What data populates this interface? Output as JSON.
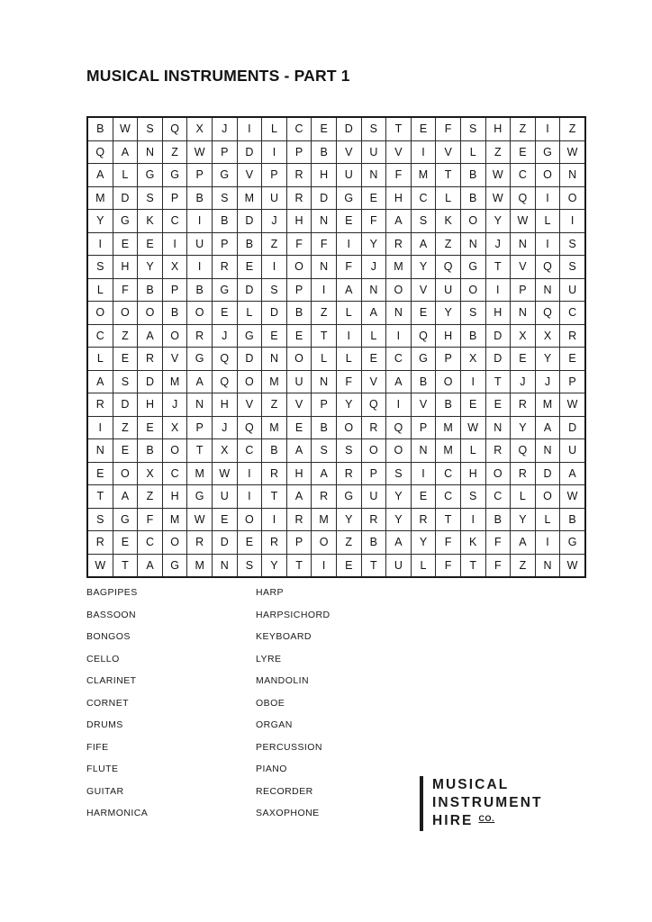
{
  "page": {
    "title": "MUSICAL INSTRUMENTS - PART 1",
    "background_color": "#ffffff",
    "text_color": "#111111"
  },
  "puzzle": {
    "type": "word-search",
    "rows": 20,
    "columns": 20,
    "border_color": "#1a1a1a",
    "grid": [
      [
        "B",
        "W",
        "S",
        "Q",
        "X",
        "J",
        "I",
        "L",
        "C",
        "E",
        "D",
        "S",
        "T",
        "E",
        "F",
        "S",
        "H",
        "Z",
        "I",
        "Z"
      ],
      [
        "Q",
        "A",
        "N",
        "Z",
        "W",
        "P",
        "D",
        "I",
        "P",
        "B",
        "V",
        "U",
        "V",
        "I",
        "V",
        "L",
        "Z",
        "E",
        "G",
        "W"
      ],
      [
        "A",
        "L",
        "G",
        "G",
        "P",
        "G",
        "V",
        "P",
        "R",
        "H",
        "U",
        "N",
        "F",
        "M",
        "T",
        "B",
        "W",
        "C",
        "O",
        "N"
      ],
      [
        "M",
        "D",
        "S",
        "P",
        "B",
        "S",
        "M",
        "U",
        "R",
        "D",
        "G",
        "E",
        "H",
        "C",
        "L",
        "B",
        "W",
        "Q",
        "I",
        "O"
      ],
      [
        "Y",
        "G",
        "K",
        "C",
        "I",
        "B",
        "D",
        "J",
        "H",
        "N",
        "E",
        "F",
        "A",
        "S",
        "K",
        "O",
        "Y",
        "W",
        "L",
        "I"
      ],
      [
        "I",
        "E",
        "E",
        "I",
        "U",
        "P",
        "B",
        "Z",
        "F",
        "F",
        "I",
        "Y",
        "R",
        "A",
        "Z",
        "N",
        "J",
        "N",
        "I",
        "S"
      ],
      [
        "S",
        "H",
        "Y",
        "X",
        "I",
        "R",
        "E",
        "I",
        "O",
        "N",
        "F",
        "J",
        "M",
        "Y",
        "Q",
        "G",
        "T",
        "V",
        "Q",
        "S"
      ],
      [
        "L",
        "F",
        "B",
        "P",
        "B",
        "G",
        "D",
        "S",
        "P",
        "I",
        "A",
        "N",
        "O",
        "V",
        "U",
        "O",
        "I",
        "P",
        "N",
        "U"
      ],
      [
        "O",
        "O",
        "O",
        "B",
        "O",
        "E",
        "L",
        "D",
        "B",
        "Z",
        "L",
        "A",
        "N",
        "E",
        "Y",
        "S",
        "H",
        "N",
        "Q",
        "C"
      ],
      [
        "C",
        "Z",
        "A",
        "O",
        "R",
        "J",
        "G",
        "E",
        "E",
        "T",
        "I",
        "L",
        "I",
        "Q",
        "H",
        "B",
        "D",
        "X",
        "X",
        "R"
      ],
      [
        "L",
        "E",
        "R",
        "V",
        "G",
        "Q",
        "D",
        "N",
        "O",
        "L",
        "L",
        "E",
        "C",
        "G",
        "P",
        "X",
        "D",
        "E",
        "Y",
        "E"
      ],
      [
        "A",
        "S",
        "D",
        "M",
        "A",
        "Q",
        "O",
        "M",
        "U",
        "N",
        "F",
        "V",
        "A",
        "B",
        "O",
        "I",
        "T",
        "J",
        "J",
        "P"
      ],
      [
        "R",
        "D",
        "H",
        "J",
        "N",
        "H",
        "V",
        "Z",
        "V",
        "P",
        "Y",
        "Q",
        "I",
        "V",
        "B",
        "E",
        "E",
        "R",
        "M",
        "W"
      ],
      [
        "I",
        "Z",
        "E",
        "X",
        "P",
        "J",
        "Q",
        "M",
        "E",
        "B",
        "O",
        "R",
        "Q",
        "P",
        "M",
        "W",
        "N",
        "Y",
        "A",
        "D"
      ],
      [
        "N",
        "E",
        "B",
        "O",
        "T",
        "X",
        "C",
        "B",
        "A",
        "S",
        "S",
        "O",
        "O",
        "N",
        "M",
        "L",
        "R",
        "Q",
        "N",
        "U"
      ],
      [
        "E",
        "O",
        "X",
        "C",
        "M",
        "W",
        "I",
        "R",
        "H",
        "A",
        "R",
        "P",
        "S",
        "I",
        "C",
        "H",
        "O",
        "R",
        "D",
        "A"
      ],
      [
        "T",
        "A",
        "Z",
        "H",
        "G",
        "U",
        "I",
        "T",
        "A",
        "R",
        "G",
        "U",
        "Y",
        "E",
        "C",
        "S",
        "C",
        "L",
        "O",
        "W"
      ],
      [
        "S",
        "G",
        "F",
        "M",
        "W",
        "E",
        "O",
        "I",
        "R",
        "M",
        "Y",
        "R",
        "Y",
        "R",
        "T",
        "I",
        "B",
        "Y",
        "L",
        "B"
      ],
      [
        "R",
        "E",
        "C",
        "O",
        "R",
        "D",
        "E",
        "R",
        "P",
        "O",
        "Z",
        "B",
        "A",
        "Y",
        "F",
        "K",
        "F",
        "A",
        "I",
        "G"
      ],
      [
        "W",
        "T",
        "A",
        "G",
        "M",
        "N",
        "S",
        "Y",
        "T",
        "I",
        "E",
        "T",
        "U",
        "L",
        "F",
        "T",
        "F",
        "Z",
        "N",
        "W"
      ]
    ]
  },
  "word_list": {
    "left_column": [
      "BAGPIPES",
      "BASSOON",
      "BONGOS",
      "CELLO",
      "CLARINET",
      "CORNET",
      "DRUMS",
      "FIFE",
      "FLUTE",
      "GUITAR",
      "HARMONICA"
    ],
    "right_column": [
      "HARP",
      "HARPSICHORD",
      "KEYBOARD",
      "LYRE",
      "MANDOLIN",
      "OBOE",
      "ORGAN",
      "PERCUSSION",
      "PIANO",
      "RECORDER",
      "SAXOPHONE"
    ]
  },
  "logo": {
    "line1": "MUSICAL",
    "line2": "INSTRUMENT",
    "line3": "HIRE",
    "suffix": "CO.",
    "color": "#1b1b1b"
  }
}
